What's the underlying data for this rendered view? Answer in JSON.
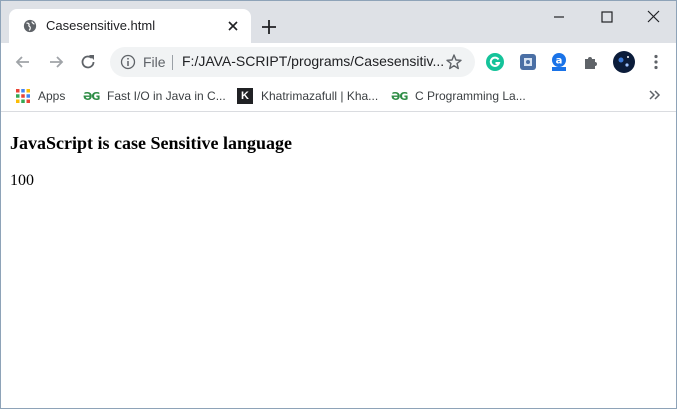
{
  "tab": {
    "title": "Casesensitive.html"
  },
  "omnibox": {
    "scheme_label": "File",
    "url": "F:/JAVA-SCRIPT/programs/Casesensitiv..."
  },
  "bookmarks": {
    "items": [
      {
        "label": "Apps",
        "icon": "apps-grid-icon"
      },
      {
        "label": "Fast I/O in Java in C...",
        "icon": "geeksforgeeks-icon"
      },
      {
        "label": "Khatrimazafull | Kha...",
        "icon": "khatrimaza-k-icon"
      },
      {
        "label": "C Programming La...",
        "icon": "geeksforgeeks-icon"
      }
    ]
  },
  "page": {
    "heading": "JavaScript is case Sensitive language",
    "output": "100"
  },
  "colors": {
    "tabstrip": "#dee1e6",
    "omnibox": "#f1f3f4",
    "grammarly": "#15c39a",
    "geeks": "#2f8d46"
  }
}
